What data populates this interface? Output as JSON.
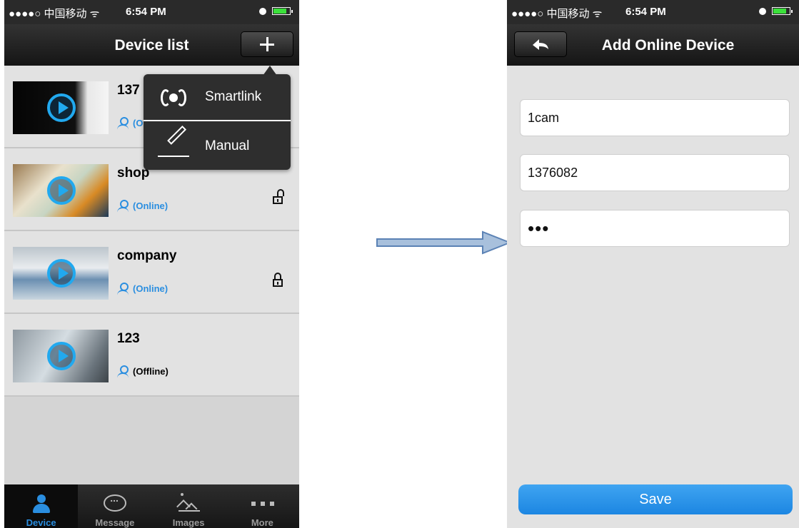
{
  "status_bar": {
    "carrier": "●●●●○ 中国移动 ᯤ",
    "time": "6:54 PM"
  },
  "device_list_screen": {
    "title": "Device list",
    "add_icon": "plus-icon",
    "devices": [
      {
        "name": "137",
        "status": "(Online)",
        "lock": "none"
      },
      {
        "name": "shop",
        "status": "(Online)",
        "lock": "unlocked"
      },
      {
        "name": "company",
        "status": "(Online)",
        "lock": "locked"
      },
      {
        "name": "123",
        "status": "(Offline)",
        "lock": "none"
      }
    ],
    "popup_menu": [
      {
        "label": "Smartlink",
        "icon": "radio-waves-icon"
      },
      {
        "label": "Manual",
        "icon": "pencil-icon"
      }
    ],
    "tabs": [
      {
        "label": "Device",
        "icon": "user-icon",
        "active": true
      },
      {
        "label": "Message",
        "icon": "chat-bubble-icon",
        "active": false
      },
      {
        "label": "Images",
        "icon": "image-icon",
        "active": false
      },
      {
        "label": "More",
        "icon": "more-dots-icon",
        "active": false
      }
    ]
  },
  "add_device_screen": {
    "title": "Add Online Device",
    "back_icon": "back-arrow-icon",
    "fields": {
      "name": "1cam",
      "device_id": "1376082",
      "password": "•••"
    },
    "save_label": "Save"
  },
  "colors": {
    "accent_blue": "#2a8ee0",
    "save_button": "#1c86e2",
    "nav_dark": "#1f1f1f",
    "transition_arrow": "#a8c0dc"
  }
}
